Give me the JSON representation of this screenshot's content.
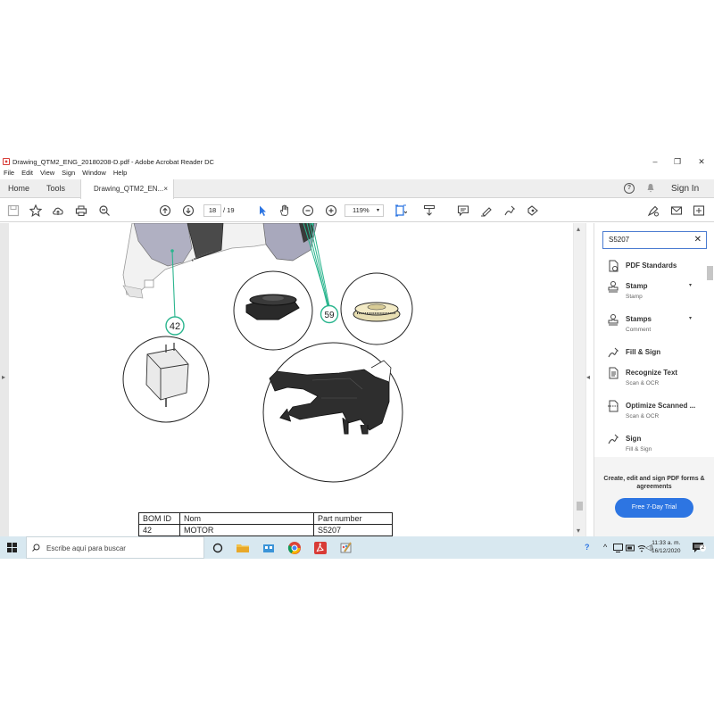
{
  "window": {
    "title": "Drawing_QTM2_ENG_20180208-D.pdf - Adobe Acrobat Reader DC",
    "controls": [
      "–",
      "❐",
      "✕"
    ]
  },
  "menu": [
    "File",
    "Edit",
    "View",
    "Sign",
    "Window",
    "Help"
  ],
  "tabs": {
    "home": "Home",
    "tools": "Tools",
    "document": "Drawing_QTM2_EN...",
    "close": "×",
    "signin": "Sign In",
    "help_glyph": "?"
  },
  "toolbar": {
    "page_current": "18",
    "page_total": "/ 19",
    "zoom": "119%",
    "zoom_caret": "▾",
    "icons": [
      "save-icon",
      "star-icon",
      "cloud-upload-icon",
      "print-icon",
      "zoom-search-icon",
      "page-up-icon",
      "page-down-icon",
      "select-cursor-icon",
      "hand-icon",
      "zoom-out-icon",
      "zoom-in-icon",
      "fit-page-icon",
      "scroll-mode-icon",
      "comment-icon",
      "highlight-icon",
      "sign-icon",
      "read-aloud-icon",
      "share-link-icon",
      "email-icon",
      "more-icon"
    ]
  },
  "drawing": {
    "callouts": [
      "42",
      "59"
    ]
  },
  "bom_table": {
    "headers": [
      "BOM ID",
      "Nom",
      "Part number"
    ],
    "rows": [
      [
        "42",
        "MOTOR",
        "S5207"
      ]
    ]
  },
  "panel": {
    "search_value": "S5207",
    "search_clear": "✕",
    "tools": [
      {
        "name": "PDF Standards",
        "sub": "",
        "icon": "pdf-standards-icon",
        "dropdown": false
      },
      {
        "name": "Stamp",
        "sub": "Stamp",
        "icon": "stamp-icon",
        "dropdown": true
      },
      {
        "name": "Stamps",
        "sub": "Comment",
        "icon": "stamps-icon",
        "dropdown": true
      },
      {
        "name": "Fill & Sign",
        "sub": "",
        "icon": "fill-sign-icon",
        "dropdown": false
      },
      {
        "name": "Recognize Text",
        "sub": "Scan & OCR",
        "icon": "recognize-text-icon",
        "dropdown": false
      },
      {
        "name": "Optimize Scanned ...",
        "sub": "Scan & OCR",
        "icon": "optimize-scan-icon",
        "dropdown": false
      },
      {
        "name": "Sign",
        "sub": "Fill & Sign",
        "icon": "sign-pen-icon",
        "dropdown": false
      }
    ],
    "promo_text": "Create, edit and sign PDF forms & agreements",
    "trial_button": "Free 7-Day Trial",
    "dropdown_glyph": "▾"
  },
  "taskbar": {
    "search_placeholder": "Escribe aquí para buscar",
    "time": "11:33 a. m.",
    "date": "16/12/2020",
    "notifications": "2",
    "tray_help": "?",
    "tray_chevron": "^"
  },
  "colors": {
    "accent": "#2d75e2",
    "callout_green": "#2bb58e",
    "acrobat_red": "#d83b36",
    "taskbar": "#d8e8f0"
  }
}
